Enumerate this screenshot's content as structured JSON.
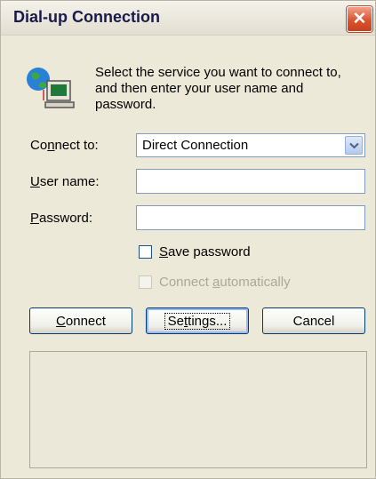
{
  "window": {
    "title": "Dial-up Connection"
  },
  "info": {
    "text": "Select the service you want to connect to, and then enter your user name and password."
  },
  "fields": {
    "connect_to": {
      "label_before": "Co",
      "label_accel": "n",
      "label_after": "nect to:",
      "value": "Direct Connection"
    },
    "user_name": {
      "label_accel": "U",
      "label_after": "ser name:",
      "value": ""
    },
    "password": {
      "label_accel": "P",
      "label_after": "assword:",
      "value": ""
    }
  },
  "checkboxes": {
    "save_password": {
      "accel": "S",
      "rest": "ave password",
      "checked": false
    },
    "connect_automatically": {
      "before": "Connect ",
      "accel": "a",
      "rest": "utomatically",
      "checked": false,
      "disabled": true
    }
  },
  "buttons": {
    "connect": {
      "accel": "C",
      "rest": "onnect"
    },
    "settings": {
      "before": "Se",
      "accel": "t",
      "rest": "tings..."
    },
    "cancel": {
      "label": "Cancel"
    }
  },
  "colors": {
    "dialog_bg": "#ECE9D8",
    "close_button": "#D9532F",
    "input_border": "#7F9DB9"
  }
}
